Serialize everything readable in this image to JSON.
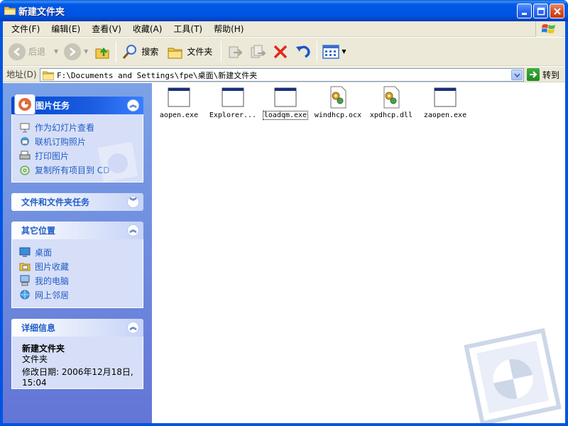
{
  "window": {
    "title": "新建文件夹",
    "brand_color": "#0054e3",
    "controls": [
      "minimize-icon",
      "maximize-icon",
      "close-icon"
    ]
  },
  "menu": {
    "items": [
      "文件(F)",
      "编辑(E)",
      "查看(V)",
      "收藏(A)",
      "工具(T)",
      "帮助(H)"
    ]
  },
  "toolbar": {
    "back_label": "后退",
    "search_label": "搜索",
    "folders_label": "文件夹"
  },
  "address": {
    "label": "地址(D)",
    "path": "F:\\Documents and Settings\\fpe\\桌面\\新建文件夹",
    "go_label": "转到"
  },
  "taskpane": {
    "picture_tasks": {
      "title": "图片任务",
      "items": [
        "作为幻灯片查看",
        "联机订购照片",
        "打印图片",
        "复制所有项目到 CD"
      ]
    },
    "file_tasks": {
      "title": "文件和文件夹任务"
    },
    "other_places": {
      "title": "其它位置",
      "items": [
        "桌面",
        "图片收藏",
        "我的电脑",
        "网上邻居"
      ]
    },
    "details": {
      "title": "详细信息",
      "name": "新建文件夹",
      "type": "文件夹",
      "modified": "修改日期: 2006年12月18日,",
      "modified_time": "15:04"
    }
  },
  "files": [
    {
      "name": "aopen.exe",
      "icon": "exe-window-icon"
    },
    {
      "name": "Explorer...",
      "icon": "exe-window-icon"
    },
    {
      "name": "loadqm.exe",
      "icon": "exe-window-icon"
    },
    {
      "name": "windhcp.ocx",
      "icon": "gear-dll-icon"
    },
    {
      "name": "xpdhcp.dll",
      "icon": "gear-dll-icon"
    },
    {
      "name": "zaopen.exe",
      "icon": "exe-window-icon"
    }
  ]
}
